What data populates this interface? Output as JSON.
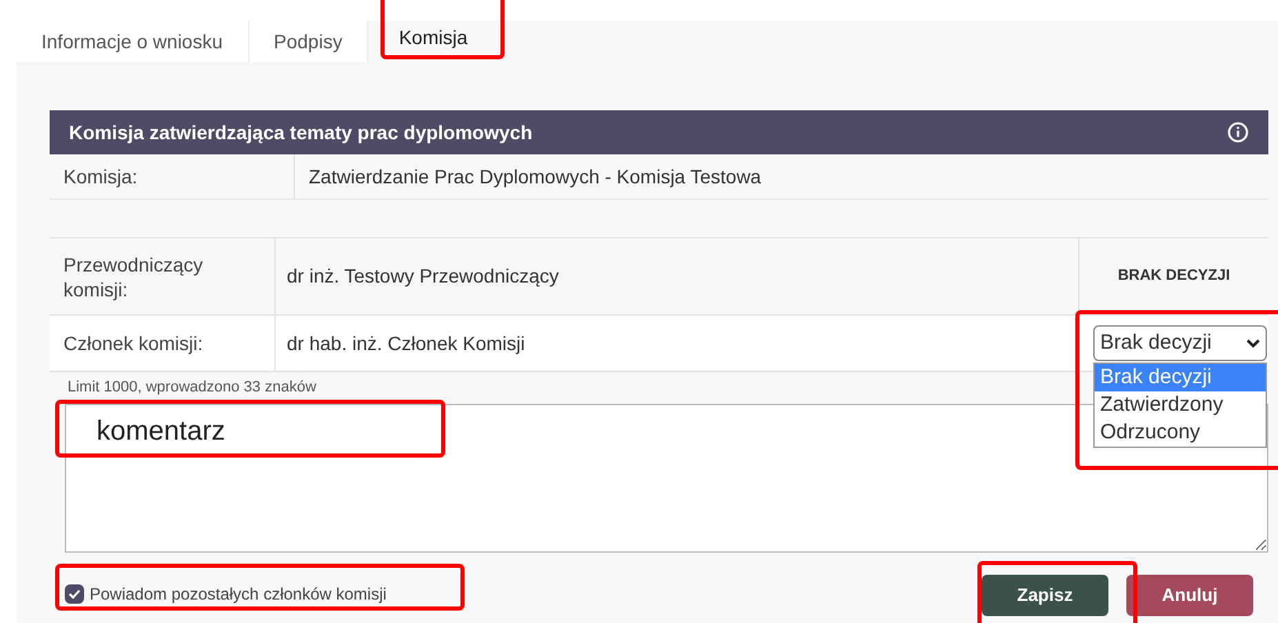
{
  "tabs": [
    {
      "label": "Informacje o wniosku",
      "selected": false
    },
    {
      "label": "Podpisy",
      "selected": false
    },
    {
      "label": "Komisja",
      "selected": true
    }
  ],
  "panel": {
    "title": "Komisja zatwierdzająca tematy prac dyplomowych",
    "label": "Komisja:",
    "value": "Zatwierdzanie Prac Dyplomowych - Komisja Testowa"
  },
  "members": [
    {
      "kind": "status",
      "role": "Przewodniczący komisji:",
      "name": "dr inż. Testowy Przewodniczący",
      "decision": "BRAK DECYZJI"
    },
    {
      "kind": "select",
      "role": "Członek komisji:",
      "name": "dr hab. inż. Członek Komisji",
      "decision": "Brak decyzji",
      "expanded": true,
      "options": [
        {
          "label": "Brak decyzji",
          "selected": true
        },
        {
          "label": "Zatwierdzony",
          "selected": false
        },
        {
          "label": "Odrzucony",
          "selected": false
        }
      ]
    }
  ],
  "comment": {
    "limit": "Limit 1000, wprowadzono 33 znaków",
    "value": "komentarz"
  },
  "notify": {
    "label": "Powiadom pozostałych członków komisji",
    "checked": true
  },
  "buttons": [
    {
      "kind": "primary",
      "label": "Zapisz"
    },
    {
      "kind": "danger",
      "label": "Anuluj"
    }
  ]
}
